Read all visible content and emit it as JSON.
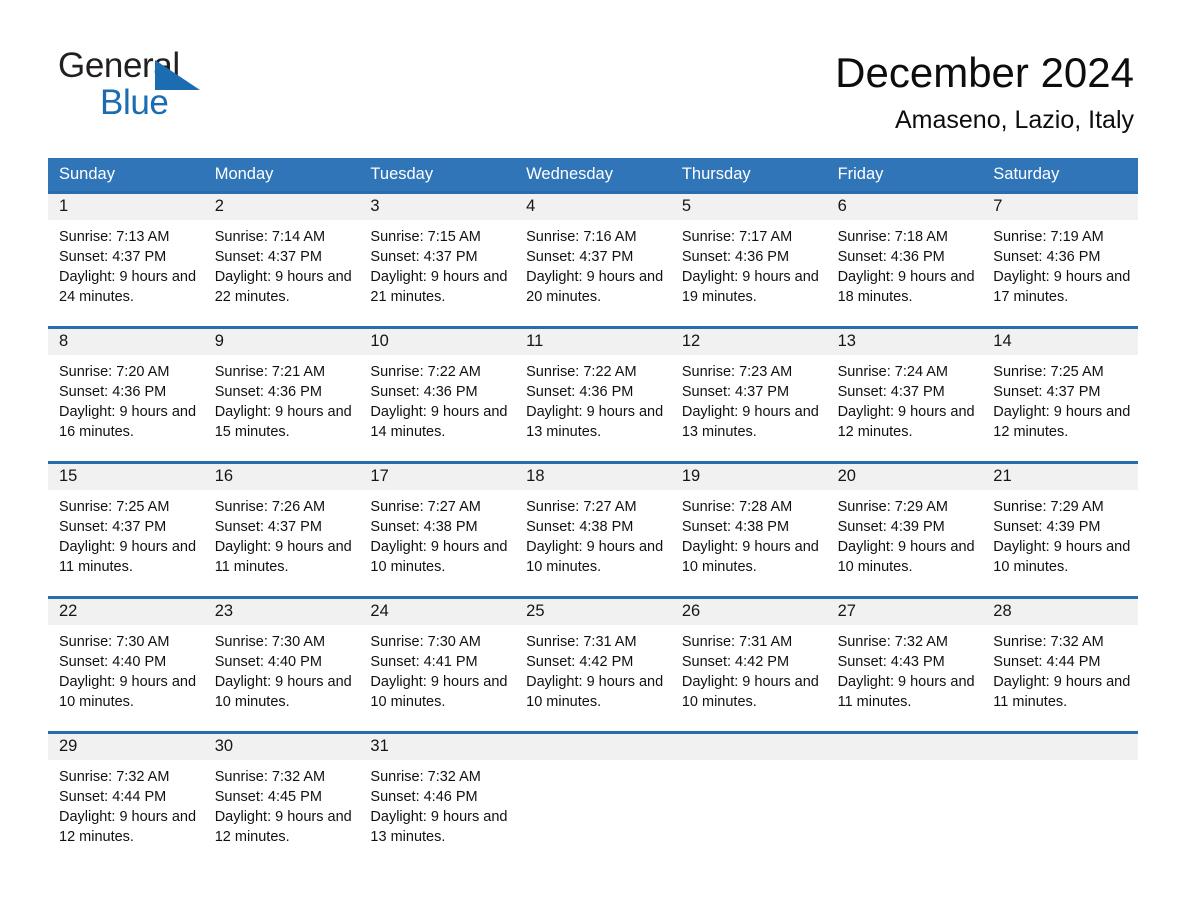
{
  "brand": {
    "name_part1": "General",
    "name_part2": "Blue",
    "logo_icon": "triangle-icon",
    "accent_color": "#1b6cb0"
  },
  "header": {
    "title": "December 2024",
    "location": "Amaseno, Lazio, Italy"
  },
  "theme": {
    "header_bar_color": "#3075b8",
    "row_divider_color": "#2a6daf",
    "day_band_color": "#f1f1f1",
    "text_color": "#111111"
  },
  "weekdays": [
    "Sunday",
    "Monday",
    "Tuesday",
    "Wednesday",
    "Thursday",
    "Friday",
    "Saturday"
  ],
  "weeks": [
    [
      {
        "day": "1",
        "sunrise": "Sunrise: 7:13 AM",
        "sunset": "Sunset: 4:37 PM",
        "daylight": "Daylight: 9 hours and 24 minutes."
      },
      {
        "day": "2",
        "sunrise": "Sunrise: 7:14 AM",
        "sunset": "Sunset: 4:37 PM",
        "daylight": "Daylight: 9 hours and 22 minutes."
      },
      {
        "day": "3",
        "sunrise": "Sunrise: 7:15 AM",
        "sunset": "Sunset: 4:37 PM",
        "daylight": "Daylight: 9 hours and 21 minutes."
      },
      {
        "day": "4",
        "sunrise": "Sunrise: 7:16 AM",
        "sunset": "Sunset: 4:37 PM",
        "daylight": "Daylight: 9 hours and 20 minutes."
      },
      {
        "day": "5",
        "sunrise": "Sunrise: 7:17 AM",
        "sunset": "Sunset: 4:36 PM",
        "daylight": "Daylight: 9 hours and 19 minutes."
      },
      {
        "day": "6",
        "sunrise": "Sunrise: 7:18 AM",
        "sunset": "Sunset: 4:36 PM",
        "daylight": "Daylight: 9 hours and 18 minutes."
      },
      {
        "day": "7",
        "sunrise": "Sunrise: 7:19 AM",
        "sunset": "Sunset: 4:36 PM",
        "daylight": "Daylight: 9 hours and 17 minutes."
      }
    ],
    [
      {
        "day": "8",
        "sunrise": "Sunrise: 7:20 AM",
        "sunset": "Sunset: 4:36 PM",
        "daylight": "Daylight: 9 hours and 16 minutes."
      },
      {
        "day": "9",
        "sunrise": "Sunrise: 7:21 AM",
        "sunset": "Sunset: 4:36 PM",
        "daylight": "Daylight: 9 hours and 15 minutes."
      },
      {
        "day": "10",
        "sunrise": "Sunrise: 7:22 AM",
        "sunset": "Sunset: 4:36 PM",
        "daylight": "Daylight: 9 hours and 14 minutes."
      },
      {
        "day": "11",
        "sunrise": "Sunrise: 7:22 AM",
        "sunset": "Sunset: 4:36 PM",
        "daylight": "Daylight: 9 hours and 13 minutes."
      },
      {
        "day": "12",
        "sunrise": "Sunrise: 7:23 AM",
        "sunset": "Sunset: 4:37 PM",
        "daylight": "Daylight: 9 hours and 13 minutes."
      },
      {
        "day": "13",
        "sunrise": "Sunrise: 7:24 AM",
        "sunset": "Sunset: 4:37 PM",
        "daylight": "Daylight: 9 hours and 12 minutes."
      },
      {
        "day": "14",
        "sunrise": "Sunrise: 7:25 AM",
        "sunset": "Sunset: 4:37 PM",
        "daylight": "Daylight: 9 hours and 12 minutes."
      }
    ],
    [
      {
        "day": "15",
        "sunrise": "Sunrise: 7:25 AM",
        "sunset": "Sunset: 4:37 PM",
        "daylight": "Daylight: 9 hours and 11 minutes."
      },
      {
        "day": "16",
        "sunrise": "Sunrise: 7:26 AM",
        "sunset": "Sunset: 4:37 PM",
        "daylight": "Daylight: 9 hours and 11 minutes."
      },
      {
        "day": "17",
        "sunrise": "Sunrise: 7:27 AM",
        "sunset": "Sunset: 4:38 PM",
        "daylight": "Daylight: 9 hours and 10 minutes."
      },
      {
        "day": "18",
        "sunrise": "Sunrise: 7:27 AM",
        "sunset": "Sunset: 4:38 PM",
        "daylight": "Daylight: 9 hours and 10 minutes."
      },
      {
        "day": "19",
        "sunrise": "Sunrise: 7:28 AM",
        "sunset": "Sunset: 4:38 PM",
        "daylight": "Daylight: 9 hours and 10 minutes."
      },
      {
        "day": "20",
        "sunrise": "Sunrise: 7:29 AM",
        "sunset": "Sunset: 4:39 PM",
        "daylight": "Daylight: 9 hours and 10 minutes."
      },
      {
        "day": "21",
        "sunrise": "Sunrise: 7:29 AM",
        "sunset": "Sunset: 4:39 PM",
        "daylight": "Daylight: 9 hours and 10 minutes."
      }
    ],
    [
      {
        "day": "22",
        "sunrise": "Sunrise: 7:30 AM",
        "sunset": "Sunset: 4:40 PM",
        "daylight": "Daylight: 9 hours and 10 minutes."
      },
      {
        "day": "23",
        "sunrise": "Sunrise: 7:30 AM",
        "sunset": "Sunset: 4:40 PM",
        "daylight": "Daylight: 9 hours and 10 minutes."
      },
      {
        "day": "24",
        "sunrise": "Sunrise: 7:30 AM",
        "sunset": "Sunset: 4:41 PM",
        "daylight": "Daylight: 9 hours and 10 minutes."
      },
      {
        "day": "25",
        "sunrise": "Sunrise: 7:31 AM",
        "sunset": "Sunset: 4:42 PM",
        "daylight": "Daylight: 9 hours and 10 minutes."
      },
      {
        "day": "26",
        "sunrise": "Sunrise: 7:31 AM",
        "sunset": "Sunset: 4:42 PM",
        "daylight": "Daylight: 9 hours and 10 minutes."
      },
      {
        "day": "27",
        "sunrise": "Sunrise: 7:32 AM",
        "sunset": "Sunset: 4:43 PM",
        "daylight": "Daylight: 9 hours and 11 minutes."
      },
      {
        "day": "28",
        "sunrise": "Sunrise: 7:32 AM",
        "sunset": "Sunset: 4:44 PM",
        "daylight": "Daylight: 9 hours and 11 minutes."
      }
    ],
    [
      {
        "day": "29",
        "sunrise": "Sunrise: 7:32 AM",
        "sunset": "Sunset: 4:44 PM",
        "daylight": "Daylight: 9 hours and 12 minutes."
      },
      {
        "day": "30",
        "sunrise": "Sunrise: 7:32 AM",
        "sunset": "Sunset: 4:45 PM",
        "daylight": "Daylight: 9 hours and 12 minutes."
      },
      {
        "day": "31",
        "sunrise": "Sunrise: 7:32 AM",
        "sunset": "Sunset: 4:46 PM",
        "daylight": "Daylight: 9 hours and 13 minutes."
      },
      {
        "day": "",
        "sunrise": "",
        "sunset": "",
        "daylight": ""
      },
      {
        "day": "",
        "sunrise": "",
        "sunset": "",
        "daylight": ""
      },
      {
        "day": "",
        "sunrise": "",
        "sunset": "",
        "daylight": ""
      },
      {
        "day": "",
        "sunrise": "",
        "sunset": "",
        "daylight": ""
      }
    ]
  ]
}
